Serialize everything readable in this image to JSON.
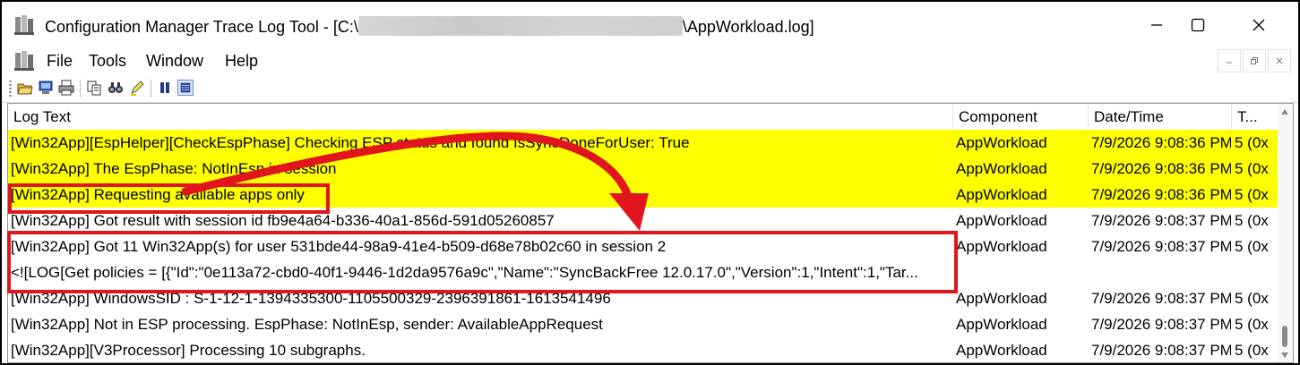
{
  "window": {
    "title_prefix": "Configuration Manager Trace Log Tool - [C:\\",
    "title_suffix": "\\AppWorkload.log]",
    "minimize_icon": "minimize-icon",
    "maximize_icon": "maximize-icon",
    "close_icon": "close-icon"
  },
  "menu": {
    "items": [
      "File",
      "Tools",
      "Window",
      "Help"
    ]
  },
  "toolbar": {
    "icons": [
      "open-folder-icon",
      "open-remote-icon",
      "print-icon",
      "copy-icon",
      "find-icon",
      "highlight-icon",
      "pause-icon",
      "log-view-icon"
    ]
  },
  "list": {
    "columns": [
      "Log Text",
      "Component",
      "Date/Time",
      "T..."
    ],
    "rows": [
      {
        "log": "[Win32App][EspHelper][CheckEspPhase] Checking ESP status and found IsSyncDoneForUser: True",
        "component": "AppWorkload",
        "datetime": "7/9/2026 9:08:36 PM",
        "thread": "5 (0x",
        "highlight": true
      },
      {
        "log": "[Win32App] The EspPhase: NotInEsp in session",
        "component": "AppWorkload",
        "datetime": "7/9/2026 9:08:36 PM",
        "thread": "5 (0x",
        "highlight": true
      },
      {
        "log": "[Win32App] Requesting available apps only",
        "component": "AppWorkload",
        "datetime": "7/9/2026 9:08:36 PM",
        "thread": "5 (0x",
        "highlight": true
      },
      {
        "log": "[Win32App] Got result with session id fb9e4a64-b336-40a1-856d-591d05260857",
        "component": "AppWorkload",
        "datetime": "7/9/2026 9:08:37 PM",
        "thread": "5 (0x",
        "highlight": false
      },
      {
        "log": "[Win32App] Got 11 Win32App(s) for user 531bde44-98a9-41e4-b509-d68e78b02c60 in session 2",
        "log_line2": "<![LOG[Get policies = [{\"Id\":\"0e113a72-cbd0-40f1-9446-1d2da9576a9c\",\"Name\":\"SyncBackFree 12.0.17.0\",\"Version\":1,\"Intent\":1,\"Tar...",
        "component": "AppWorkload",
        "datetime": "7/9/2026 9:08:37 PM",
        "thread": "5 (0x",
        "highlight": false
      },
      {
        "log": "[Win32App] WindowsSID : S-1-12-1-1394335300-1105500329-2396391861-1613541496",
        "component": "AppWorkload",
        "datetime": "7/9/2026 9:08:37 PM",
        "thread": "5 (0x",
        "highlight": false
      },
      {
        "log": "[Win32App] Not in ESP processing. EspPhase: NotInEsp, sender: AvailableAppRequest",
        "component": "AppWorkload",
        "datetime": "7/9/2026 9:08:37 PM",
        "thread": "5 (0x",
        "highlight": false
      },
      {
        "log": "[Win32App][V3Processor] Processing 10 subgraphs.",
        "component": "AppWorkload",
        "datetime": "7/9/2026 9:08:37 PM",
        "thread": "5 (0x",
        "highlight": false
      }
    ]
  },
  "colors": {
    "highlight": "#ffff00",
    "annotation": "#e0151d"
  }
}
